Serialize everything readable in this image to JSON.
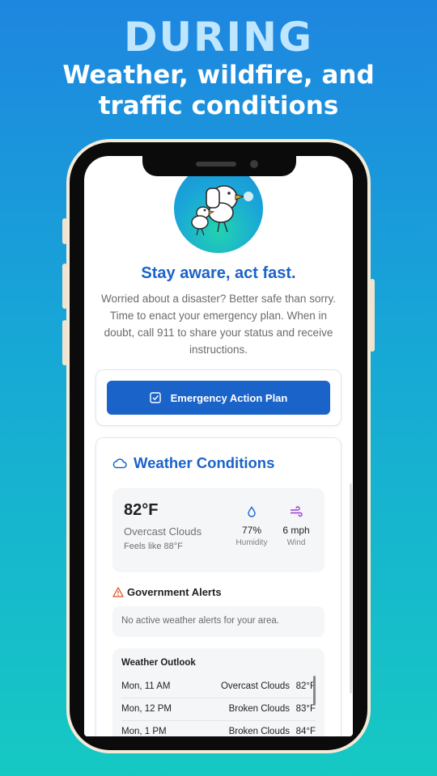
{
  "headline": {
    "top": "DURING",
    "line1": "Weather, wildfire, and",
    "line2": "traffic conditions"
  },
  "app": {
    "title": "Stay aware, act fast.",
    "intro": "Worried about a disaster? Better safe than sorry. Time to enact your emergency plan. When in doubt, call 911 to share your status and receive instructions.",
    "plan_button": "Emergency Action Plan",
    "accent": "#1a63c9"
  },
  "weather": {
    "title": "Weather Conditions",
    "temp": "82°F",
    "condition": "Overcast Clouds",
    "feels_like": "Feels like 88°F",
    "humidity_value": "77%",
    "humidity_label": "Humidity",
    "wind_value": "6 mph",
    "wind_label": "Wind"
  },
  "alerts": {
    "title": "Government Alerts",
    "message": "No active weather alerts for your area."
  },
  "outlook": {
    "title": "Weather Outlook",
    "rows": [
      {
        "time": "Mon, 11 AM",
        "condition": "Overcast Clouds",
        "temp": "82°F"
      },
      {
        "time": "Mon, 12 PM",
        "condition": "Broken Clouds",
        "temp": "83°F"
      },
      {
        "time": "Mon, 1 PM",
        "condition": "Broken Clouds",
        "temp": "84°F"
      }
    ]
  }
}
